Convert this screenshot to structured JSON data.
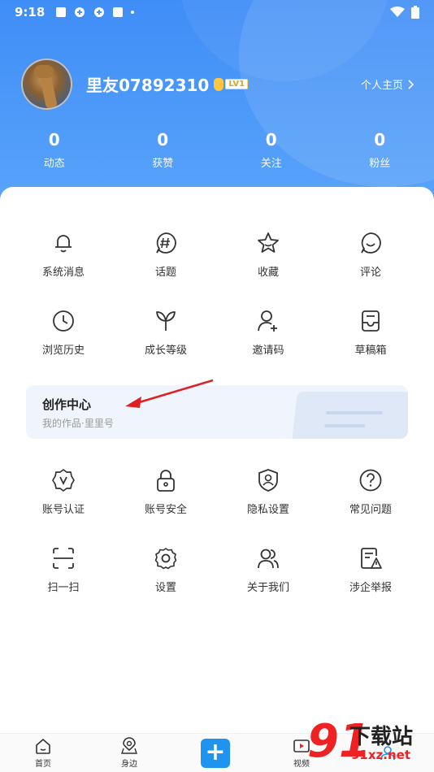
{
  "status_bar": {
    "time": "9:18"
  },
  "profile": {
    "username": "里友07892310",
    "level": "LV1",
    "homepage_link": "个人主页"
  },
  "stats": [
    {
      "value": "0",
      "label": "动态"
    },
    {
      "value": "0",
      "label": "获赞"
    },
    {
      "value": "0",
      "label": "关注"
    },
    {
      "value": "0",
      "label": "粉丝"
    }
  ],
  "menu_row1": [
    {
      "label": "系统消息",
      "icon": "bell-icon"
    },
    {
      "label": "话题",
      "icon": "hashtag-icon"
    },
    {
      "label": "收藏",
      "icon": "star-icon"
    },
    {
      "label": "评论",
      "icon": "comment-icon"
    }
  ],
  "menu_row2": [
    {
      "label": "浏览历史",
      "icon": "history-icon"
    },
    {
      "label": "成长等级",
      "icon": "leaf-icon"
    },
    {
      "label": "邀请码",
      "icon": "add-user-icon"
    },
    {
      "label": "草稿箱",
      "icon": "drafts-icon"
    }
  ],
  "creator_center": {
    "title": "创作中心",
    "subtitle": "我的作品·里里号"
  },
  "menu_row3": [
    {
      "label": "账号认证",
      "icon": "verify-badge-icon"
    },
    {
      "label": "账号安全",
      "icon": "lock-icon"
    },
    {
      "label": "隐私设置",
      "icon": "shield-user-icon"
    },
    {
      "label": "常见问题",
      "icon": "question-icon"
    }
  ],
  "menu_row4": [
    {
      "label": "扫一扫",
      "icon": "scan-icon"
    },
    {
      "label": "设置",
      "icon": "gear-icon"
    },
    {
      "label": "关于我们",
      "icon": "users-icon"
    },
    {
      "label": "涉企举报",
      "icon": "report-icon"
    }
  ],
  "tabbar": {
    "home": "首页",
    "nearby": "身边",
    "video": "视频"
  },
  "watermark": {
    "big": "91",
    "cn": "下载站",
    "url": "91xz.net"
  },
  "colors": {
    "header": "#3f8df7",
    "accent": "#1e93f0",
    "arrow": "#e02020"
  }
}
